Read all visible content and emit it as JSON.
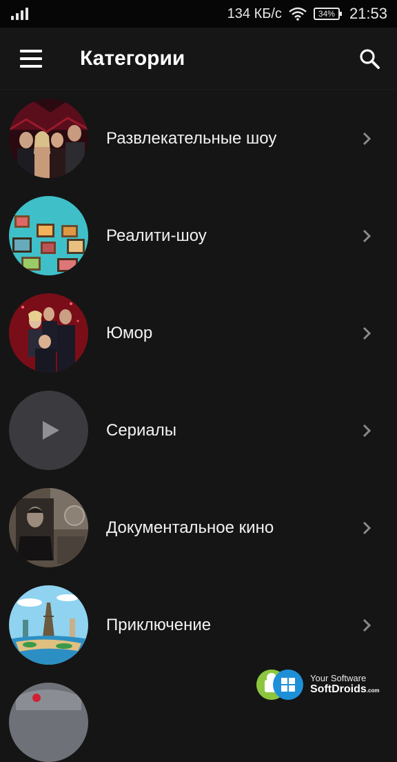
{
  "status_bar": {
    "network_speed": "134 КБ/с",
    "battery_percent": "34%",
    "time": "21:53",
    "icons": [
      "signal-icon",
      "wifi-icon",
      "battery-icon"
    ]
  },
  "app_bar": {
    "title": "Категории",
    "menu_icon": "menu-icon",
    "search_icon": "search-icon"
  },
  "categories": [
    {
      "label": "Развлекательные шоу",
      "thumbnail": "entertainment-show-image"
    },
    {
      "label": "Реалити-шоу",
      "thumbnail": "reality-show-image"
    },
    {
      "label": "Юмор",
      "thumbnail": "humor-image"
    },
    {
      "label": "Сериалы",
      "thumbnail": "play-icon"
    },
    {
      "label": "Документальное кино",
      "thumbnail": "documentary-image"
    },
    {
      "label": "Приключение",
      "thumbnail": "adventure-image"
    }
  ],
  "watermark": {
    "line1": "Your Software",
    "line2": "SoftDroids",
    "suffix": ".com"
  },
  "colors": {
    "background": "#151515",
    "status_bar": "#060606",
    "text": "#f2f2f2",
    "chevron": "#8a8a8a"
  }
}
